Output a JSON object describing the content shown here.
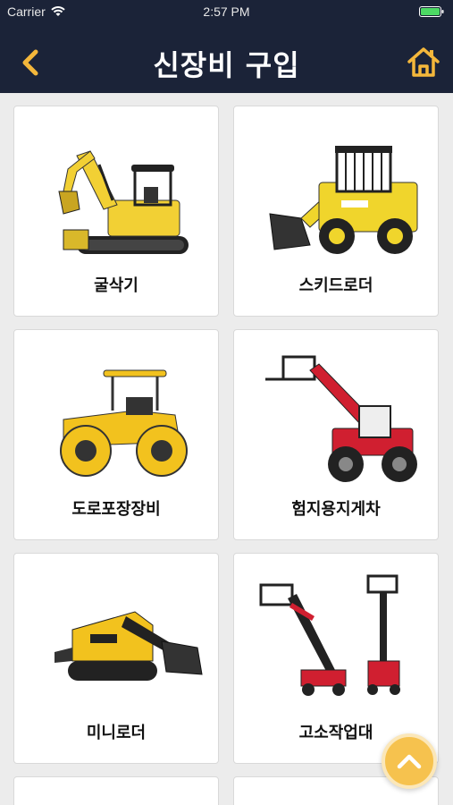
{
  "status_bar": {
    "carrier": "Carrier",
    "time": "2:57 PM"
  },
  "nav": {
    "title": "신장비 구입"
  },
  "categories": [
    {
      "label": "굴삭기",
      "icon": "excavator-illustration"
    },
    {
      "label": "스키드로더",
      "icon": "skid-loader-illustration"
    },
    {
      "label": "도로포장장비",
      "icon": "road-roller-illustration"
    },
    {
      "label": "험지용지게차",
      "icon": "telehandler-illustration"
    },
    {
      "label": "미니로더",
      "icon": "mini-loader-illustration"
    },
    {
      "label": "고소작업대",
      "icon": "aerial-lift-illustration"
    }
  ],
  "colors": {
    "header_bg": "#1b2338",
    "accent": "#f4b73b",
    "page_bg": "#ececec"
  }
}
